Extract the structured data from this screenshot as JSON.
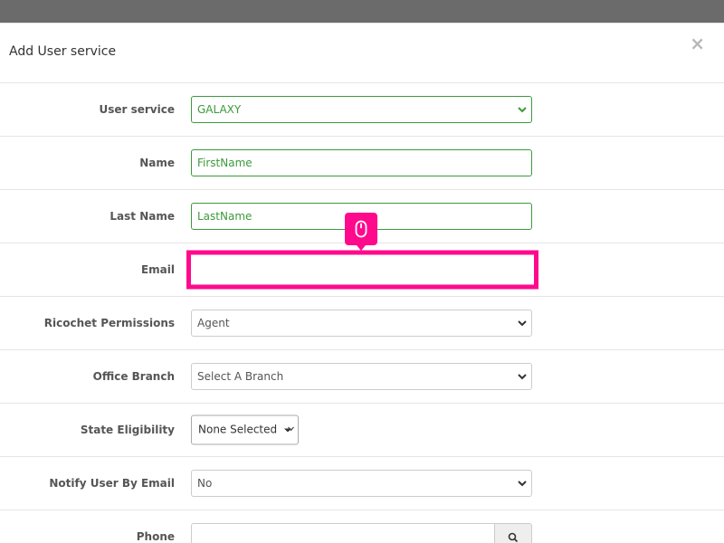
{
  "modal": {
    "title": "Add User service",
    "close_label": "×"
  },
  "form": {
    "user_service": {
      "label": "User service",
      "value": "GALAXY"
    },
    "name": {
      "label": "Name",
      "placeholder": "FirstName"
    },
    "last_name": {
      "label": "Last Name",
      "placeholder": "LastName"
    },
    "email": {
      "label": "Email",
      "value": ""
    },
    "ricochet_permissions": {
      "label": "Ricochet Permissions",
      "value": "Agent"
    },
    "office_branch": {
      "label": "Office Branch",
      "value": "Select A Branch"
    },
    "state_eligibility": {
      "label": "State Eligibility",
      "value": "None Selected"
    },
    "notify_user_by_email": {
      "label": "Notify User By Email",
      "value": "No"
    },
    "phone": {
      "label": "Phone",
      "value": ""
    }
  },
  "colors": {
    "highlight": "#ff0a8c",
    "valid": "#3c9a3c"
  },
  "icons": {
    "tooltip": "mouse-icon",
    "phone_button": "search-icon"
  }
}
